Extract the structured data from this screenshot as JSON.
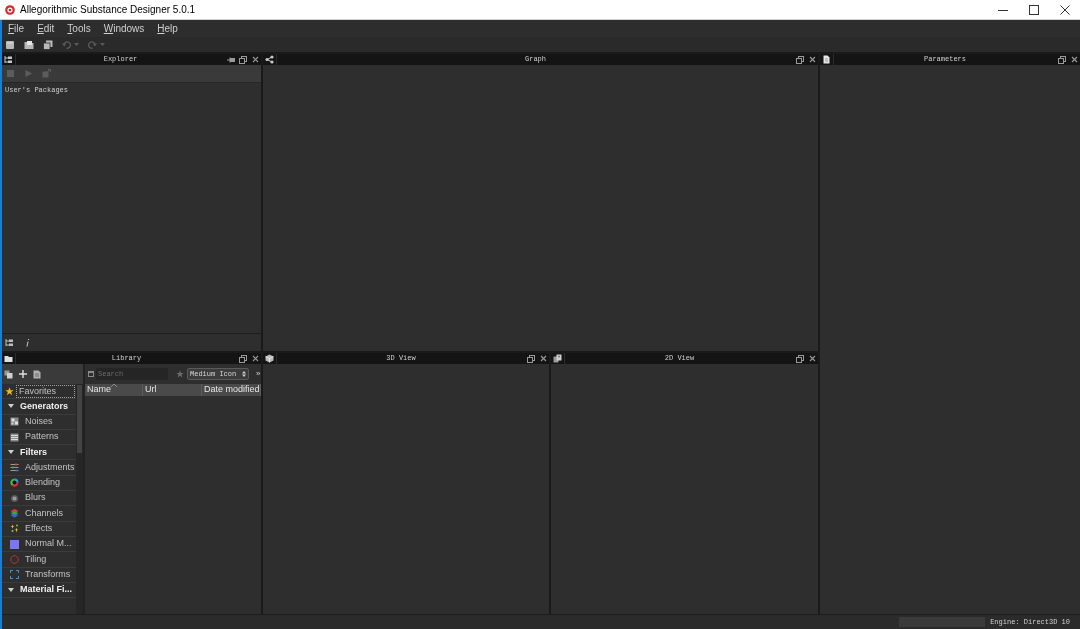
{
  "window": {
    "title": "Allegorithmic Substance Designer 5.0.1"
  },
  "menu": [
    {
      "label": "File"
    },
    {
      "label": "Edit"
    },
    {
      "label": "Tools"
    },
    {
      "label": "Windows"
    },
    {
      "label": "Help"
    }
  ],
  "toolbar": [
    {
      "disabled": false
    },
    {
      "disabled": false
    },
    {
      "disabled": false
    },
    {
      "disabled": true
    },
    {
      "disabled": true
    }
  ],
  "explorer": {
    "title": "Explorer",
    "toolbar": [
      {
        "disabled": true
      },
      {
        "disabled": true
      },
      {
        "disabled": true
      }
    ],
    "items": [
      "User's Packages"
    ]
  },
  "graph": {
    "title": "Graph"
  },
  "parameters": {
    "title": "Parameters"
  },
  "library": {
    "title": "Library",
    "tree": [
      {
        "kind": "item",
        "label": "Favorites",
        "selected": true
      },
      {
        "kind": "group",
        "label": "Generators",
        "selected": false,
        "expanded": true,
        "children": [
          {
            "kind": "item",
            "label": "Noises",
            "selected": false
          },
          {
            "kind": "item",
            "label": "Patterns",
            "selected": false
          }
        ]
      },
      {
        "kind": "group",
        "label": "Filters",
        "selected": false,
        "expanded": true,
        "children": [
          {
            "kind": "item",
            "label": "Adjustments",
            "selected": false
          },
          {
            "kind": "item",
            "label": "Blending",
            "selected": false
          },
          {
            "kind": "item",
            "label": "Blurs",
            "selected": false
          },
          {
            "kind": "item",
            "label": "Channels",
            "selected": false
          },
          {
            "kind": "item",
            "label": "Effects",
            "selected": false
          },
          {
            "kind": "item",
            "label": "Normal M...",
            "selected": false
          },
          {
            "kind": "item",
            "label": "Tiling",
            "selected": false
          },
          {
            "kind": "item",
            "label": "Transforms",
            "selected": false
          }
        ]
      },
      {
        "kind": "group",
        "label": "Material Fi...",
        "selected": false,
        "expanded": true
      }
    ],
    "search": {
      "placeholder": "Search"
    },
    "view_mode": "Medium Icon",
    "overflow": "»",
    "columns": [
      {
        "label": "Name",
        "sorted": true
      },
      {
        "label": "Url",
        "sorted": false
      },
      {
        "label": "Date modified",
        "sorted": false
      }
    ]
  },
  "view_3d": {
    "title": "3D View"
  },
  "view_2d": {
    "title": "2D View"
  },
  "status_bar": {
    "engine": "Engine: Direct3D 10"
  }
}
